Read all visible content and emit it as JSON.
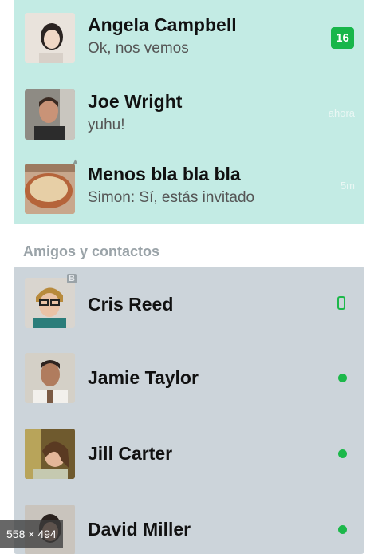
{
  "recent": {
    "items": [
      {
        "name": "Angela Campbell",
        "message": "Ok, nos vemos",
        "badge": "16"
      },
      {
        "name": "Joe Wright",
        "message": "yuhu!",
        "time": "ahora"
      },
      {
        "name": "Menos bla bla bla",
        "message": "Simon: Sí, estás invitado",
        "time": "5m",
        "icon": "group-icon"
      }
    ]
  },
  "friends": {
    "title": "Amigos y contactos",
    "items": [
      {
        "name": "Cris Reed",
        "status": "mobile-icon",
        "corner_icon": "B"
      },
      {
        "name": "Jamie Taylor",
        "status": "online-dot-icon"
      },
      {
        "name": "Jill Carter",
        "status": "online-dot-icon"
      },
      {
        "name": "David Miller",
        "status": "online-dot-icon"
      }
    ]
  },
  "overlay": {
    "size_text": "558 × 494"
  },
  "colors": {
    "accent_green": "#17b64a",
    "recent_bg": "#c3ebe4",
    "friends_bg": "#ccd4da"
  }
}
